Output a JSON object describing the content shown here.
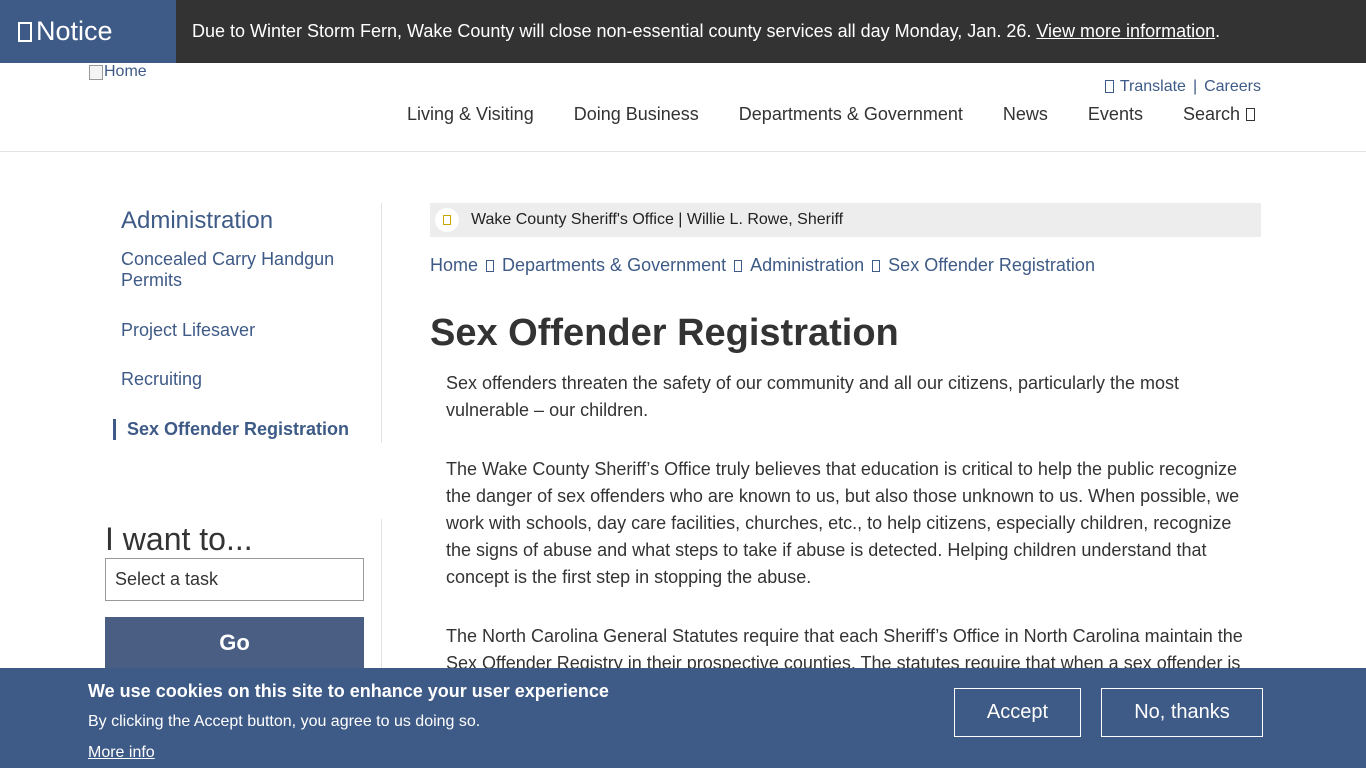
{
  "notice": {
    "tag": "Notice",
    "message": "Due to Winter Storm Fern, Wake County will close non-essential county services all day Monday, Jan. 26.",
    "link": "View more information",
    "link_suffix": "."
  },
  "header": {
    "logo_alt": "Home",
    "utility": {
      "translate": "Translate",
      "separator": "|",
      "careers": "Careers"
    },
    "nav": [
      "Living & Visiting",
      "Doing Business",
      "Departments & Government",
      "News",
      "Events"
    ],
    "search": "Search"
  },
  "sidebar": {
    "title": "Administration",
    "items": [
      "Concealed Carry Handgun Permits",
      "Project Lifesaver",
      "Recruiting",
      "Sex Offender Registration"
    ],
    "active_index": 3
  },
  "want": {
    "title": "I want to...",
    "select_value": "Select a task",
    "go": "Go"
  },
  "agency": {
    "text": "Wake County Sheriff's Office | Willie L. Rowe, Sheriff"
  },
  "breadcrumb": [
    "Home",
    "Departments & Government",
    "Administration",
    "Sex Offender Registration"
  ],
  "page": {
    "title": "Sex Offender Registration",
    "paragraphs": [
      "Sex offenders threaten the safety of our community and all our citizens, particularly the most vulnerable – our children.",
      "The Wake County Sheriff’s Office truly believes that education is critical to help the public recognize the danger of sex offenders who are known to us, but also those unknown to us. When possible, we work with schools, day care facilities, churches, etc., to help citizens, especially children, recognize the signs of abuse and what steps to take if abuse is detected. Helping children understand that concept is the first step in stopping the abuse.",
      "The North Carolina General Statutes require that each Sheriff’s Office in North Carolina maintain the Sex Offender Registry in their prospective counties. The statutes require that when a sex offender is"
    ]
  },
  "cookie": {
    "heading": "We use cookies on this site to enhance your user experience",
    "sub": "By clicking the Accept button, you agree to us doing so.",
    "more": "More info",
    "accept": "Accept",
    "decline": "No, thanks"
  },
  "colors": {
    "brand": "#3e5a86",
    "notice_bg": "#333333",
    "go_button": "#4a5d83"
  }
}
